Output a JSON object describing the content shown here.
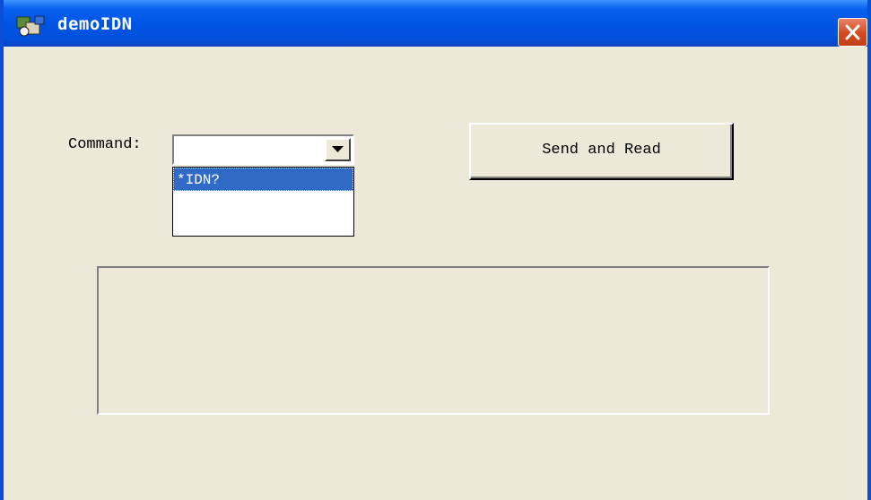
{
  "window": {
    "title": "demoIDN"
  },
  "form": {
    "command_label": "Command:",
    "command_value": "",
    "options": [
      "*IDN?"
    ],
    "selected_index": 0,
    "send_label": "Send and Read",
    "output_text": ""
  },
  "colors": {
    "titlebar": "#0054e3",
    "face": "#ece9d8",
    "selection": "#316ac5",
    "close": "#d44920"
  },
  "icons": [
    "app-icon",
    "close-icon",
    "dropdown-arrow-icon"
  ]
}
